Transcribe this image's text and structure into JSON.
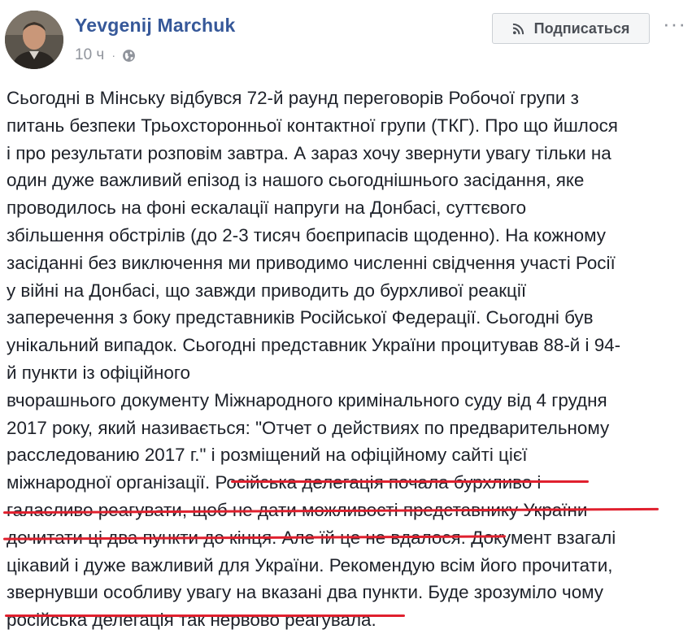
{
  "post": {
    "author": "Yevgenij Marchuk",
    "time": "10 ч",
    "separator": "·",
    "avatar_icon": "profile-photo",
    "privacy_icon": "globe-icon",
    "subscribe_label": "Подписаться",
    "subscribe_icon": "rss-icon",
    "more_label": "···",
    "lines": [
      "Сьогодні в Мінську відбувся 72-й раунд переговорів Робочої групи з",
      "питань безпеки Трьохсторонньої контактної групи (ТКГ). Про що йшлося",
      "і про результати розповім завтра. А зараз хочу звернути увагу тільки на",
      "один дуже важливий епізод із нашого сьогоднішнього засідання, яке",
      "проводилось на фоні ескалації напруги на Донбасі, суттєвого",
      "збільшення обстрілів (до 2-3 тисяч боєприпасів щоденно). На кожному",
      "засіданні без виключення ми приводимо численні свідчення участі Росії",
      "у війні на Донбасі, що завжди приводить до бурхливої реакції",
      "заперечення з боку представників Російської Федерації. Сьогодні був",
      "унікальний випадок. Сьогодні представник України процитував 88-й і 94-",
      "й пункти із офіційного",
      "вчорашнього документу Міжнародного кримінального суду від 4 грудня",
      "2017 року, який називається: \"Отчет о действиях по предварительному",
      "расследованию 2017 г.\" і розміщений на офіційному сайті цієї",
      "міжнародної організації. Російська делегація почала бурхливо і",
      "галасливо реагувати, щоб не дати можливості представнику України",
      "дочитати ці два пункти до кінця. Але їй це не вдалося. Документ взагалі",
      "цікавий і дуже важливий для України. Рекомендую всім його прочитати,",
      "звернувши особливу увагу на вказані два пункти. Буде зрозуміло чому",
      "російська делегація так нервово реагувала."
    ]
  },
  "colors": {
    "author": "#365899",
    "meta": "#90949c",
    "text": "#1d2129",
    "underline": "#e0202e",
    "button_bg": "#f5f6f7",
    "button_border": "#ccd0d5"
  }
}
